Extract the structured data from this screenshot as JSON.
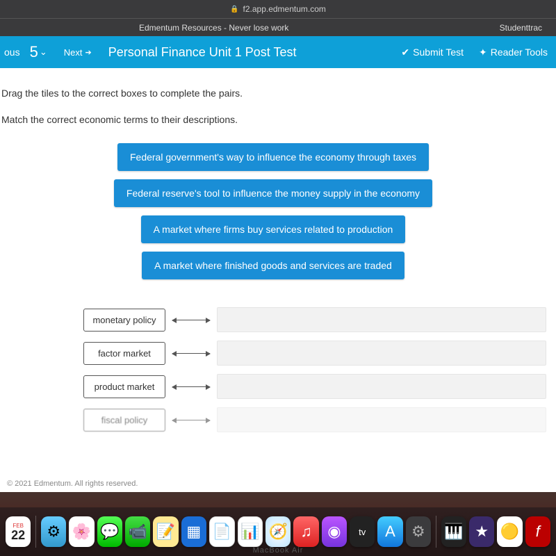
{
  "browser": {
    "url": "f2.app.edmentum.com",
    "bookmark_center": "Edmentum Resources - Never lose work",
    "bookmark_right": "Studenttrac"
  },
  "appbar": {
    "prev_fragment": "ous",
    "question_number": "5",
    "next_label": "Next",
    "title": "Personal Finance Unit 1 Post Test",
    "submit_label": "Submit Test",
    "reader_label": "Reader Tools"
  },
  "question": {
    "instruction1": "Drag the tiles to the correct boxes to complete the pairs.",
    "instruction2": "Match the correct economic terms to their descriptions.",
    "tiles": [
      "Federal government's way to influence the economy through taxes",
      "Federal reserve's tool to influence the money supply in the economy",
      "A market where firms buy services related to production",
      "A market where finished goods and services are traded"
    ],
    "terms": [
      "monetary policy",
      "factor market",
      "product market",
      "fiscal policy"
    ]
  },
  "footer": "© 2021 Edmentum. All rights reserved.",
  "dock": {
    "calendar_month": "FEB",
    "calendar_day": "22",
    "tv_label": "tv"
  },
  "device": "MacBook Air"
}
